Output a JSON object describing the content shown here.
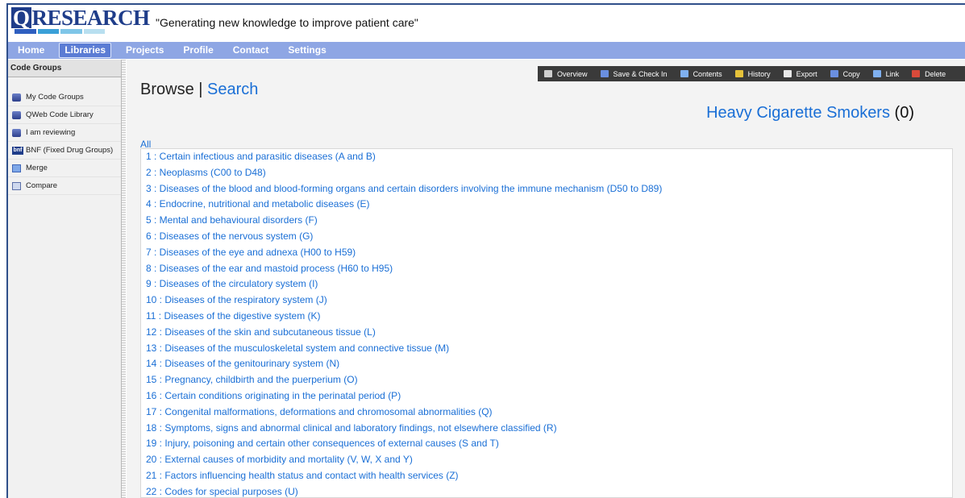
{
  "header": {
    "logo_q": "Q",
    "logo_text": "RESEARCH",
    "tagline": "\"Generating new knowledge to improve patient care\""
  },
  "nav": [
    {
      "label": "Home",
      "active": false
    },
    {
      "label": "Libraries",
      "active": true
    },
    {
      "label": "Projects",
      "active": false
    },
    {
      "label": "Profile",
      "active": false
    },
    {
      "label": "Contact",
      "active": false
    },
    {
      "label": "Settings",
      "active": false
    }
  ],
  "sidebar": {
    "title": "Code Groups",
    "items": [
      {
        "label": "My Code Groups",
        "icon": "database-icon"
      },
      {
        "label": "QWeb Code Library",
        "icon": "database-icon"
      },
      {
        "label": "I am reviewing",
        "icon": "database-icon"
      },
      {
        "label": "BNF (Fixed Drug Groups)",
        "icon": "bnf-icon"
      },
      {
        "label": "Merge",
        "icon": "merge-icon"
      },
      {
        "label": "Compare",
        "icon": "compare-icon"
      }
    ]
  },
  "toolbar": [
    {
      "label": "Overview",
      "icon": "home-icon",
      "color": "#cfcfcf"
    },
    {
      "label": "Save & Check In",
      "icon": "save-icon",
      "color": "#6a8fe0"
    },
    {
      "label": "Contents",
      "icon": "magnifier-icon",
      "color": "#7fb0f0"
    },
    {
      "label": "History",
      "icon": "history-icon",
      "color": "#e6c23a"
    },
    {
      "label": "Export",
      "icon": "export-icon",
      "color": "#e8e8e8"
    },
    {
      "label": "Copy",
      "icon": "copy-icon",
      "color": "#6a8fe0"
    },
    {
      "label": "Link",
      "icon": "link-icon",
      "color": "#7fb0f0"
    },
    {
      "label": "Delete",
      "icon": "delete-icon",
      "color": "#d84a3a"
    }
  ],
  "main": {
    "browse_label": "Browse",
    "separator": " | ",
    "search_label": "Search",
    "codegroup_name": "Heavy Cigarette Smokers",
    "codegroup_count": "(0)",
    "all_link": "All"
  },
  "chapters": [
    "1 : Certain infectious and parasitic diseases (A and B)",
    "2 : Neoplasms (C00 to D48)",
    "3 : Diseases of the blood and blood-forming organs and certain disorders involving the immune mechanism (D50 to D89)",
    "4 : Endocrine, nutritional and metabolic diseases (E)",
    "5 : Mental and behavioural disorders (F)",
    "6 : Diseases of the nervous system (G)",
    "7 : Diseases of the eye and adnexa (H00 to H59)",
    "8 : Diseases of the ear and mastoid process (H60 to H95)",
    "9 : Diseases of the circulatory system (I)",
    "10 : Diseases of the respiratory system (J)",
    "11 : Diseases of the digestive system (K)",
    "12 : Diseases of the skin and subcutaneous tissue (L)",
    "13 : Diseases of the musculoskeletal system and connective tissue (M)",
    "14 : Diseases of the genitourinary system (N)",
    "15 : Pregnancy, childbirth and the puerperium (O)",
    "16 : Certain conditions originating in the perinatal period (P)",
    "17 : Congenital malformations, deformations and chromosomal abnormalities (Q)",
    "18 : Symptoms, signs and abnormal clinical and laboratory findings, not elsewhere classified (R)",
    "19 : Injury, poisoning and certain other consequences of external causes (S and T)",
    "20 : External causes of morbidity and mortality (V, W, X and Y)",
    "21 : Factors influencing health status and contact with health services (Z)",
    "22 : Codes for special purposes (U)"
  ],
  "colors": {
    "navbar": "#8ea6e4",
    "link": "#1a6fd6",
    "brand": "#1f3d8a",
    "toolbar": "#3a3a3a"
  }
}
